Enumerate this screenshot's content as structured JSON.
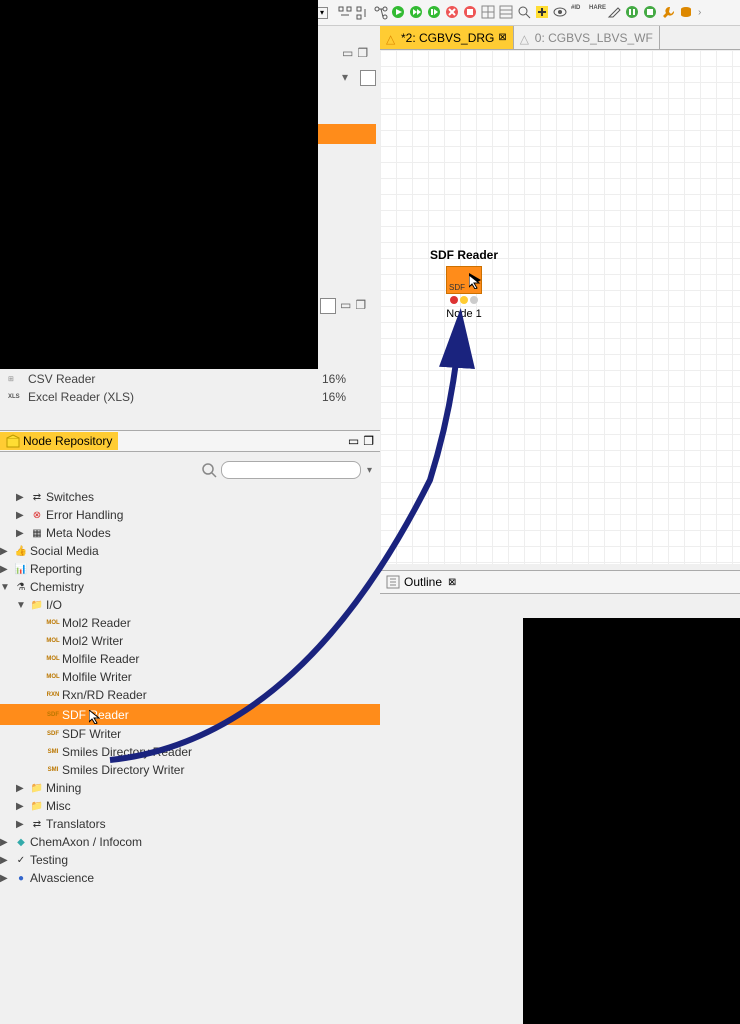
{
  "toolbar": {
    "icons": [
      "dropdown",
      "align-h",
      "align-v",
      "branch"
    ]
  },
  "tabs": [
    {
      "label": "*2: CGBVS_DRG",
      "active": true,
      "icon": "△"
    },
    {
      "label": "0: CGBVS_LBVS_WF",
      "active": false,
      "icon": "△"
    }
  ],
  "node": {
    "title": "SDF Reader",
    "badge": "SDF",
    "label": "Node 1"
  },
  "outline": {
    "title": "Outline"
  },
  "recent": [
    {
      "icon": "CSV",
      "label": "CSV Reader",
      "pct": "16%"
    },
    {
      "icon": "XLS",
      "label": "Excel Reader (XLS)",
      "pct": "16%"
    }
  ],
  "repo": {
    "title": "Node Repository"
  },
  "search": {
    "placeholder": ""
  },
  "tree": [
    {
      "level": 1,
      "arrow": "▶",
      "icon": "⇄",
      "label": "Switches"
    },
    {
      "level": 1,
      "arrow": "▶",
      "icon": "⊗",
      "label": "Error Handling",
      "iconColor": "#d33"
    },
    {
      "level": 1,
      "arrow": "▶",
      "icon": "▦",
      "label": "Meta Nodes"
    },
    {
      "level": 0,
      "arrow": "▶",
      "icon": "👍",
      "label": "Social Media"
    },
    {
      "level": 0,
      "arrow": "▶",
      "icon": "📊",
      "label": "Reporting"
    },
    {
      "level": 0,
      "arrow": "▼",
      "icon": "⚗",
      "label": "Chemistry"
    },
    {
      "level": 1,
      "arrow": "▼",
      "icon": "📁",
      "label": "I/O"
    },
    {
      "level": 2,
      "arrow": "",
      "icon": "MOL",
      "label": "Mol2 Reader"
    },
    {
      "level": 2,
      "arrow": "",
      "icon": "MOL",
      "label": "Mol2 Writer"
    },
    {
      "level": 2,
      "arrow": "",
      "icon": "MOL",
      "label": "Molfile Reader"
    },
    {
      "level": 2,
      "arrow": "",
      "icon": "MOL",
      "label": "Molfile Writer"
    },
    {
      "level": 2,
      "arrow": "",
      "icon": "RXN",
      "label": "Rxn/RD Reader"
    },
    {
      "level": 2,
      "arrow": "",
      "icon": "SDF",
      "label": "SDF Reader",
      "selected": true
    },
    {
      "level": 2,
      "arrow": "",
      "icon": "SDF",
      "label": "SDF Writer"
    },
    {
      "level": 2,
      "arrow": "",
      "icon": "SMI",
      "label": "Smiles Directory Reader"
    },
    {
      "level": 2,
      "arrow": "",
      "icon": "SMI",
      "label": "Smiles Directory Writer"
    },
    {
      "level": 1,
      "arrow": "▶",
      "icon": "📁",
      "label": "Mining"
    },
    {
      "level": 1,
      "arrow": "▶",
      "icon": "📁",
      "label": "Misc"
    },
    {
      "level": 1,
      "arrow": "▶",
      "icon": "⇄",
      "label": "Translators"
    },
    {
      "level": 0,
      "arrow": "▶",
      "icon": "◆",
      "label": "ChemAxon / Infocom",
      "iconColor": "#3aa"
    },
    {
      "level": 0,
      "arrow": "▶",
      "icon": "✓",
      "label": "Testing"
    },
    {
      "level": 0,
      "arrow": "▶",
      "icon": "●",
      "label": "Alvascience",
      "iconColor": "#36c"
    }
  ]
}
